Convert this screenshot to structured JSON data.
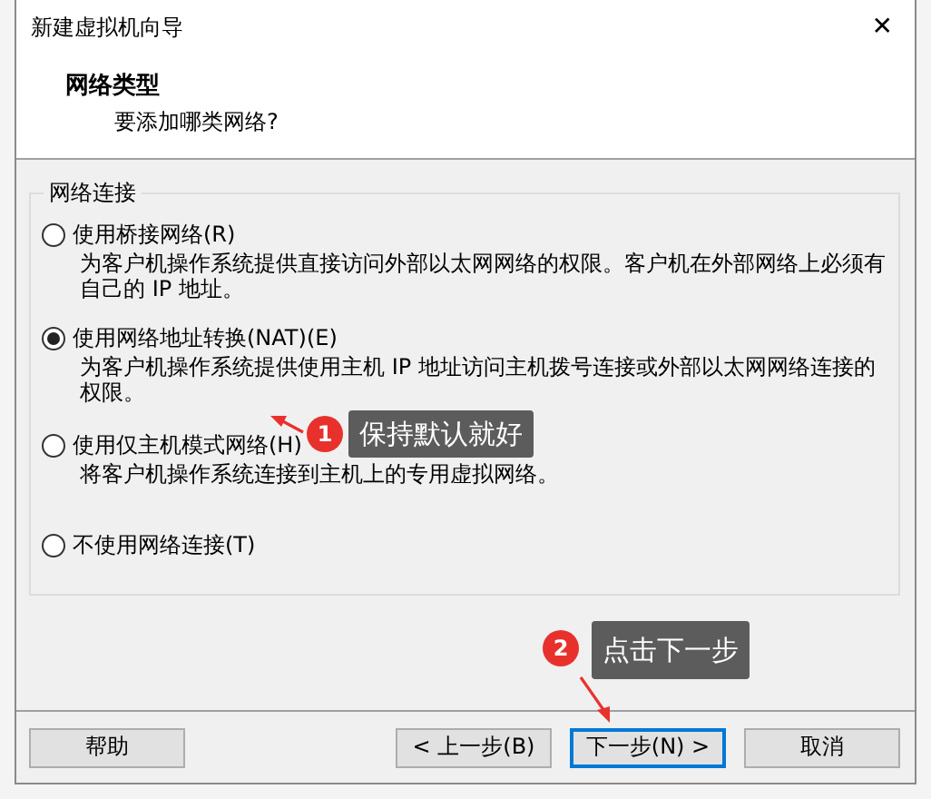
{
  "window": {
    "title": "新建虚拟机向导",
    "close": "✕"
  },
  "header": {
    "title": "网络类型",
    "subtitle": "要添加哪类网络?"
  },
  "group": {
    "label": "网络连接",
    "options": [
      {
        "label": "使用桥接网络(R)",
        "description": "为客户机操作系统提供直接访问外部以太网网络的权限。客户机在外部网络上必须有自己的 IP 地址。",
        "selected": false
      },
      {
        "label": "使用网络地址转换(NAT)(E)",
        "description": "为客户机操作系统提供使用主机 IP 地址访问主机拨号连接或外部以太网网络连接的权限。",
        "selected": true
      },
      {
        "label": "使用仅主机模式网络(H)",
        "description": "将客户机操作系统连接到主机上的专用虚拟网络。",
        "selected": false
      },
      {
        "label": "不使用网络连接(T)",
        "selected": false
      }
    ]
  },
  "buttons": [
    {
      "label": "帮助",
      "focused": false
    },
    {
      "label": "< 上一步(B)",
      "focused": false
    },
    {
      "label": "下一步(N) >",
      "focused": true
    },
    {
      "label": "取消",
      "focused": false
    }
  ],
  "annotations": [
    {
      "number": "1",
      "text": "保持默认就好"
    },
    {
      "number": "2",
      "text": "点击下一步"
    }
  ]
}
